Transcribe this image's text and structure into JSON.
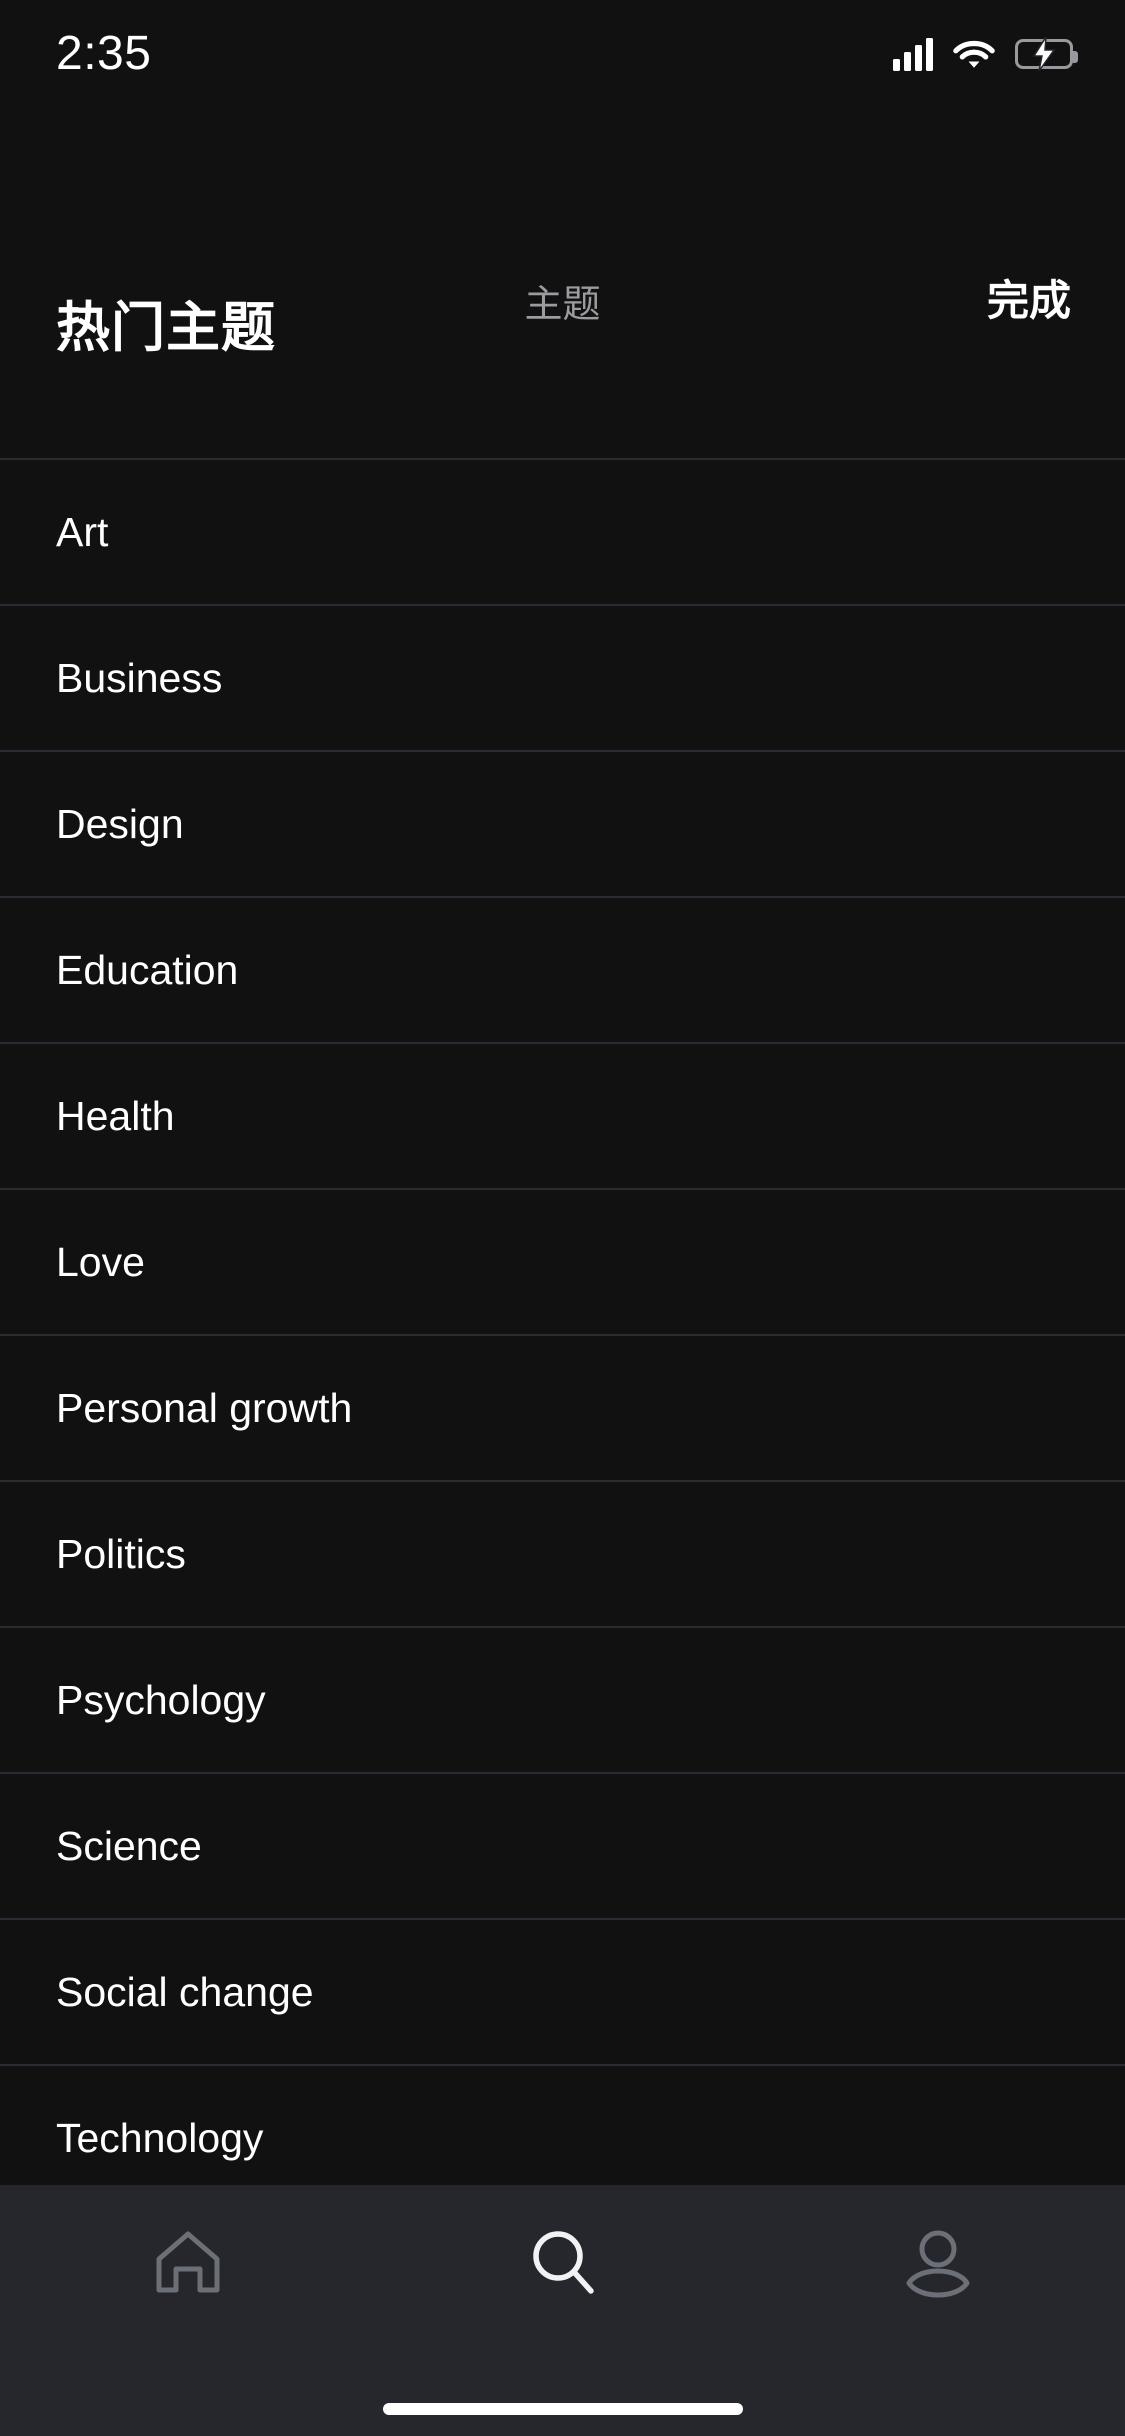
{
  "status_bar": {
    "time": "2:35",
    "signal_icon": "cellular-signal-icon",
    "wifi_icon": "wifi-icon",
    "battery_icon": "battery-charging-icon",
    "battery_color": "#5ddc6e"
  },
  "nav_bar": {
    "title": "主题",
    "title_color": "#9b9ba0",
    "action_label": "完成",
    "action_color": "#ffffff"
  },
  "section": {
    "header": "热门主题"
  },
  "topics": [
    {
      "label": "Art"
    },
    {
      "label": "Business"
    },
    {
      "label": "Design"
    },
    {
      "label": "Education"
    },
    {
      "label": "Health"
    },
    {
      "label": "Love"
    },
    {
      "label": "Personal growth"
    },
    {
      "label": "Politics"
    },
    {
      "label": "Psychology"
    },
    {
      "label": "Science"
    },
    {
      "label": "Social change"
    },
    {
      "label": "Technology"
    }
  ],
  "tab_bar": {
    "background": "#26272d",
    "items": [
      {
        "icon": "home-icon",
        "active": false,
        "color": "#6b6f78"
      },
      {
        "icon": "search-icon",
        "active": true,
        "color": "#f2f2f5"
      },
      {
        "icon": "profile-icon",
        "active": false,
        "color": "#6b6f78"
      }
    ]
  },
  "colors": {
    "page_background": "#111111",
    "divider": "#2a2b33",
    "text_primary": "#ffffff",
    "text_secondary": "#9b9ba0"
  }
}
